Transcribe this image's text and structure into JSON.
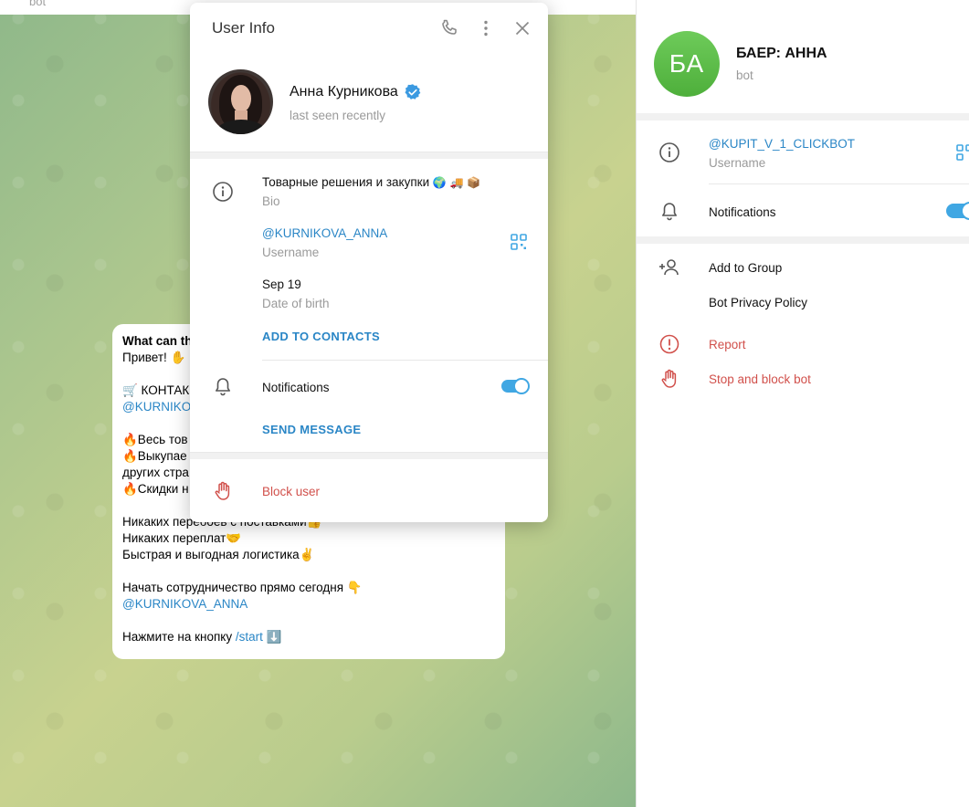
{
  "chat": {
    "header_subtitle": "bot",
    "message": {
      "heading": "What can th",
      "lines": [
        "Привет! ✋",
        "",
        "🛒 КОНТАК",
        "@KURNIKOVA",
        "",
        "🔥Весь тов",
        "🔥Выкупае",
        "других стра",
        "🔥Скидки н",
        "",
        "Никаких перебоев с поставками👍",
        "Никаких переплат🤝",
        "Быстрая и выгодная логистика✌",
        "",
        "Начать сотрудничество прямо сегодня 👇",
        "@KURNIKOVA_ANNA",
        "",
        "Нажмите на кнопку "
      ],
      "start_link": "/start",
      "start_suffix": " ⬇️"
    }
  },
  "right_panel": {
    "avatar_initials": "БА",
    "title": "БАЕР: АННА",
    "subtitle": "bot",
    "username": "@KUPIT_V_1_CLICKBOT",
    "username_label": "Username",
    "notifications_label": "Notifications",
    "notifications_on": true,
    "add_to_group": "Add to Group",
    "privacy_policy": "Bot Privacy Policy",
    "report": "Report",
    "stop_block": "Stop and block bot"
  },
  "modal": {
    "title": "User Info",
    "name": "Анна Курникова",
    "status": "last seen recently",
    "bio": "Товарные решения и закупки",
    "bio_emoji": "🌍 🚚 📦",
    "bio_label": "Bio",
    "username": "@KURNIKOVA_ANNA",
    "username_label": "Username",
    "birth": "Sep 19",
    "birth_label": "Date of birth",
    "add_contacts": "ADD TO CONTACTS",
    "notifications_label": "Notifications",
    "notifications_on": true,
    "send_message": "SEND MESSAGE",
    "block_user": "Block user"
  },
  "colors": {
    "accent": "#2a86c6",
    "toggle": "#40a7e3",
    "danger": "#d1504b",
    "bot_avatar": "#5bbd47"
  }
}
